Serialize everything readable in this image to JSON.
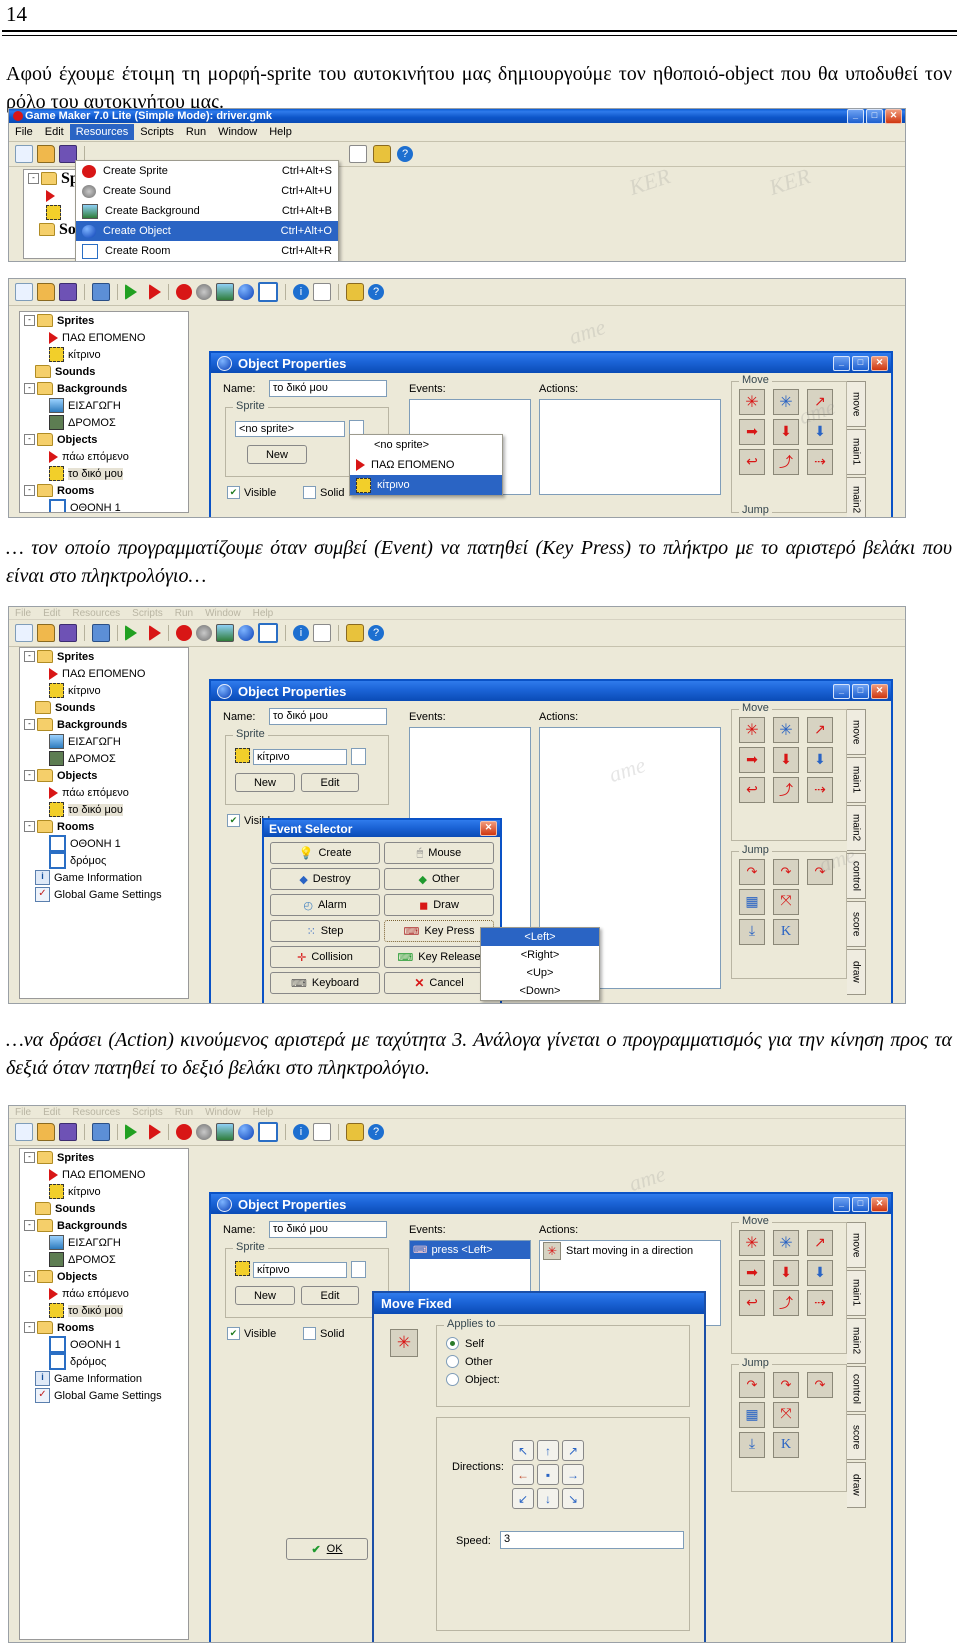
{
  "page": {
    "number": "14"
  },
  "paragraphs": {
    "p1": "Αφού έχουμε έτοιμη τη μορφή-sprite του αυτοκινήτου μας δημιουργούμε τον ηθοποιό-object που θα υποδυθεί τον ρόλο του αυτοκινήτου μας.",
    "p2": "… τον οποίο προγραμματίζουμε όταν συμβεί (Event) να πατηθεί (Key Press) το πλήκτρο με το αριστερό βελάκι που είναι στο πληκτρολόγιο…",
    "p3": "…να δράσει (Action) κινούμενος αριστερά με ταχύτητα 3. Ανάλογα γίνεται ο προγραμματισμός για την κίνηση προς τα δεξιά όταν πατηθεί το δεξιό βελάκι στο πληκτρολόγιο."
  },
  "app": {
    "title": "Game Maker 7.0 Lite (Simple Mode): driver.gmk",
    "menu": [
      "File",
      "Edit",
      "Resources",
      "Scripts",
      "Run",
      "Window",
      "Help"
    ],
    "menu_selected": "Resources",
    "caption_buttons": [
      "minimize",
      "maximize",
      "close"
    ]
  },
  "resources_menu": {
    "items": [
      {
        "label": "Create Sprite",
        "shortcut": "Ctrl+Alt+S",
        "icon": "sprite-icon",
        "selected": false
      },
      {
        "label": "Create Sound",
        "shortcut": "Ctrl+Alt+U",
        "icon": "sound-icon",
        "selected": false
      },
      {
        "label": "Create Background",
        "shortcut": "Ctrl+Alt+B",
        "icon": "background-icon",
        "selected": false
      },
      {
        "label": "Create Object",
        "shortcut": "Ctrl+Alt+O",
        "icon": "object-icon",
        "selected": true
      },
      {
        "label": "Create Room",
        "shortcut": "Ctrl+Alt+R",
        "icon": "room-icon",
        "selected": false
      }
    ]
  },
  "tree": {
    "nodes": [
      {
        "label": "Sprites",
        "type": "folder",
        "bold": true,
        "depth": 0,
        "expander": "-",
        "icon": "folder-icon"
      },
      {
        "label": "ΠΑΩ ΕΠΟΜΕΝΟ",
        "type": "leaf",
        "bold": false,
        "depth": 1,
        "expander": "",
        "icon": "sprite-arrow-icon"
      },
      {
        "label": "κίτρινο",
        "type": "leaf",
        "bold": false,
        "depth": 1,
        "expander": "",
        "icon": "car-sprite-icon"
      },
      {
        "label": "Sounds",
        "type": "folder",
        "bold": true,
        "depth": 0,
        "expander": "",
        "icon": "folder-icon"
      },
      {
        "label": "Backgrounds",
        "type": "folder",
        "bold": true,
        "depth": 0,
        "expander": "-",
        "icon": "folder-icon"
      },
      {
        "label": "ΕΙΣΑΓΩΓΗ",
        "type": "leaf",
        "bold": false,
        "depth": 1,
        "expander": "",
        "icon": "background-img-icon"
      },
      {
        "label": "ΔΡΟΜΟΣ",
        "type": "leaf",
        "bold": false,
        "depth": 1,
        "expander": "",
        "icon": "road-icon"
      },
      {
        "label": "Objects",
        "type": "folder",
        "bold": true,
        "depth": 0,
        "expander": "-",
        "icon": "folder-icon"
      },
      {
        "label": "πάω επόμενο",
        "type": "leaf",
        "bold": false,
        "depth": 1,
        "expander": "",
        "icon": "object-arrow-icon"
      },
      {
        "label": "το δικό μου",
        "type": "leaf",
        "bold": false,
        "depth": 1,
        "expander": "",
        "icon": "car-sprite-icon",
        "selected": true
      },
      {
        "label": "Rooms",
        "type": "folder",
        "bold": true,
        "depth": 0,
        "expander": "-",
        "icon": "folder-icon"
      },
      {
        "label": "ΟΘΟΝΗ 1",
        "type": "leaf",
        "bold": false,
        "depth": 1,
        "expander": "",
        "icon": "room-icon"
      },
      {
        "label": "δρόμος",
        "type": "leaf",
        "bold": false,
        "depth": 1,
        "expander": "",
        "icon": "room-icon"
      },
      {
        "label": "Game Information",
        "type": "leaf",
        "bold": false,
        "depth": 0,
        "expander": "",
        "icon": "info-icon"
      },
      {
        "label": "Global Game Settings",
        "type": "leaf",
        "bold": false,
        "depth": 0,
        "expander": "",
        "icon": "settings-icon"
      }
    ]
  },
  "object_properties": {
    "title": "Object Properties",
    "name_label": "Name:",
    "name_value": "το δικό μου",
    "sprite_group": "Sprite",
    "sprite_value_empty": "<no sprite>",
    "sprite_value_set": "κίτρινο",
    "new_button": "New",
    "edit_button": "Edit",
    "visible_label": "Visible",
    "solid_label": "Solid",
    "visible_checked": true,
    "solid_checked": false,
    "events_label": "Events:",
    "actions_label": "Actions:",
    "event_item": "press <Left>",
    "action_item": "Start moving in a direction"
  },
  "sprite_dropdown": {
    "items": [
      "<no sprite>",
      "ΠΑΩ ΕΠΟΜΕΝΟ",
      "κίτρινο"
    ],
    "selected": "κίτρινο"
  },
  "action_panel": {
    "move_group": "Move",
    "jump_group": "Jump",
    "tabs": [
      "move",
      "main1",
      "main2",
      "control",
      "score",
      "draw"
    ],
    "selected_tab": "move"
  },
  "event_selector": {
    "title": "Event Selector",
    "buttons_left": [
      "Create",
      "Destroy",
      "Alarm",
      "Step",
      "Collision",
      "Keyboard"
    ],
    "buttons_right": [
      "Mouse",
      "Other",
      "Draw",
      "Key Press",
      "Key Release",
      "Cancel"
    ],
    "focused_button": "Key Press",
    "key_list": [
      "<Left>",
      "<Right>",
      "<Up>",
      "<Down>"
    ],
    "key_selected": "<Left>"
  },
  "move_fixed": {
    "title": "Move Fixed",
    "applies_to_label": "Applies to",
    "options": [
      "Self",
      "Other",
      "Object:"
    ],
    "selected_option": "Self",
    "directions_label": "Directions:",
    "selected_direction": "left",
    "speed_label": "Speed:",
    "speed_value": "3",
    "ok_button": "OK"
  },
  "colors": {
    "title_blue": "#0a52c6",
    "dialog_face": "#ece9d8",
    "highlight": "#2a64c4",
    "red_icon": "#d81616"
  }
}
